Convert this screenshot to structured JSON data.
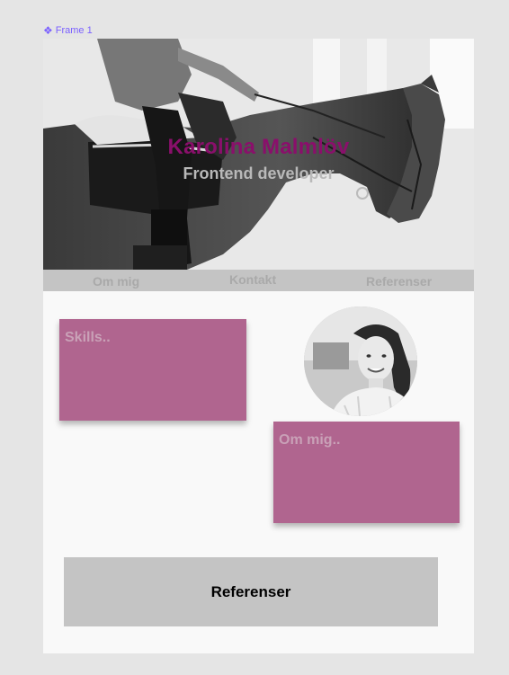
{
  "frame": {
    "label": "Frame 1",
    "icon": "component-icon"
  },
  "hero": {
    "name": "Karolina Malmlöv",
    "subtitle": "Frontend developer",
    "image": "horse-rider-photo"
  },
  "nav": {
    "items": [
      {
        "label": "Om mig"
      },
      {
        "label": "Kontakt"
      },
      {
        "label": "Referenser"
      }
    ]
  },
  "cards": {
    "skills": {
      "title": "Skills.."
    },
    "about": {
      "title": "Om mig.."
    }
  },
  "avatar": {
    "image": "profile-photo"
  },
  "references_button": {
    "label": "Referenser"
  },
  "colors": {
    "accent": "#8a0f6b",
    "card": "#b0658f",
    "nav_bg": "#c4c4c4",
    "frame_label": "#7b61ff"
  }
}
